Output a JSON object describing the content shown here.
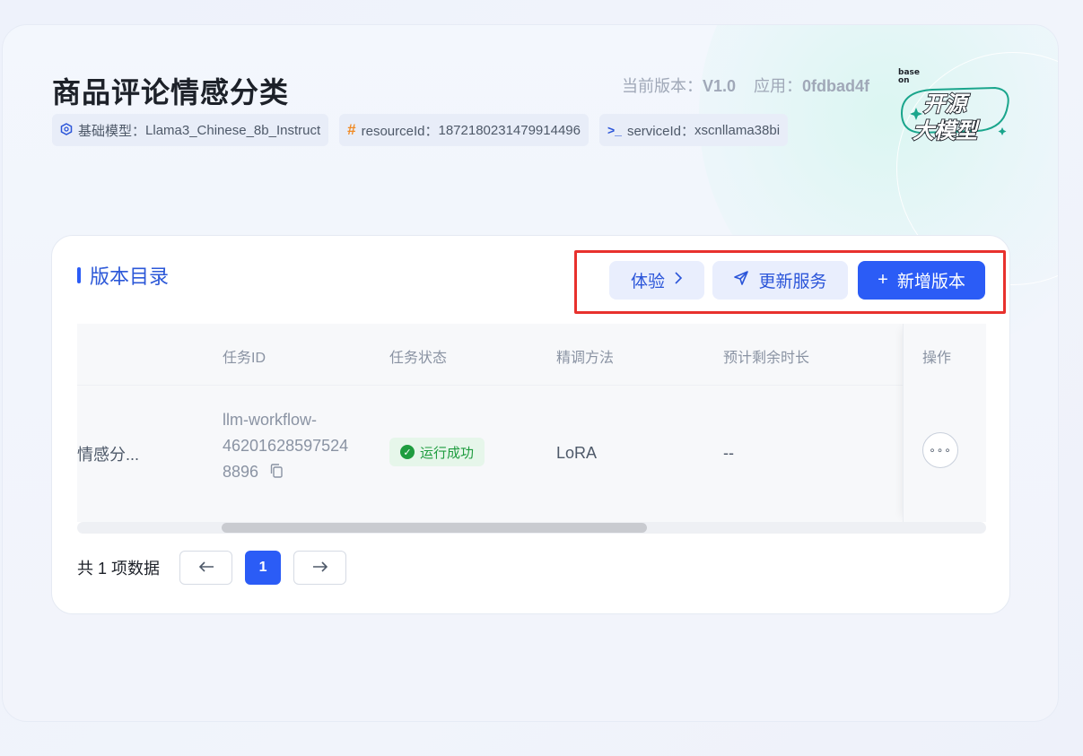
{
  "header": {
    "title": "商品评论情感分类",
    "current_version_label": "当前版本：",
    "current_version": "V1.0",
    "app_label": "应用：",
    "app_id": "0fdbad4f",
    "tags": [
      {
        "icon": "model-icon",
        "label": "基础模型：",
        "value": "Llama3_Chinese_8b_Instruct"
      },
      {
        "icon": "hash-icon",
        "label": "resourceId：",
        "value": "1872180231479914496"
      },
      {
        "icon": "terminal-icon",
        "label": "serviceId：",
        "value": "xscnllama38bi"
      }
    ],
    "logo": {
      "small": "base on",
      "line1": "开源",
      "line2": "大模型"
    }
  },
  "section": {
    "title": "版本目录",
    "buttons": {
      "experience": "体验",
      "update_service": "更新服务",
      "new_version": "新增版本"
    }
  },
  "table": {
    "columns": [
      "任务ID",
      "任务状态",
      "精调方法",
      "预计剩余时长",
      "操作"
    ],
    "rows": [
      {
        "name": "情感分...",
        "task_id_lines": [
          "llm-workflow-",
          "46201628597524",
          "8896"
        ],
        "status": "运行成功",
        "method": "LoRA",
        "remaining": "--",
        "more": "∘∘∘"
      }
    ]
  },
  "pagination": {
    "total_text": "共 1 项数据",
    "current_page": "1"
  },
  "colors": {
    "primary": "#2b5cf6",
    "success": "#1e9c3f",
    "highlight_border": "#e8312d"
  }
}
